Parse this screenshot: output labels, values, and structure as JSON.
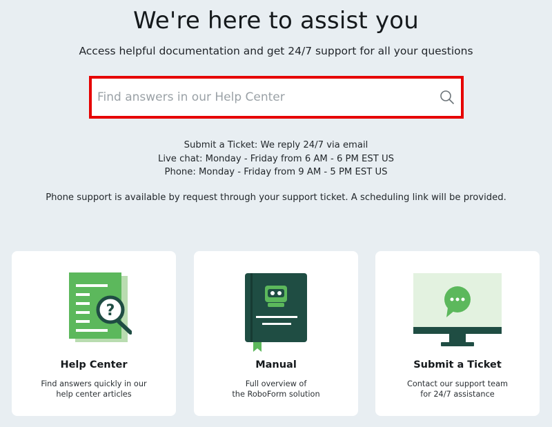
{
  "hero": {
    "title": "We're here to assist you",
    "subtitle": "Access helpful documentation and get 24/7 support for all your questions"
  },
  "search": {
    "placeholder": "Find answers in our Help Center",
    "icon": "search-icon",
    "highlight_color": "#e60000"
  },
  "support_hours": [
    "Submit a Ticket: We reply 24/7 via email",
    "Live chat: Monday - Friday from 6 AM - 6 PM EST US",
    "Phone: Monday - Friday from 9 AM - 5 PM EST US"
  ],
  "phone_note": "Phone support is available by request through your support ticket. A scheduling link will be provided.",
  "cards": [
    {
      "title": "Help Center",
      "desc_line1": "Find answers quickly in our",
      "desc_line2": "help center articles",
      "icon": "help-center-document-icon"
    },
    {
      "title": "Manual",
      "desc_line1": "Full overview of",
      "desc_line2": "the RoboForm solution",
      "icon": "manual-book-icon"
    },
    {
      "title": "Submit a Ticket",
      "desc_line1": "Contact our support team",
      "desc_line2": "for 24/7 assistance",
      "icon": "submit-ticket-monitor-icon"
    }
  ],
  "colors": {
    "background": "#e8eef2",
    "card": "#ffffff",
    "brand_green": "#5cb85c",
    "brand_dark": "#1f4d43"
  }
}
